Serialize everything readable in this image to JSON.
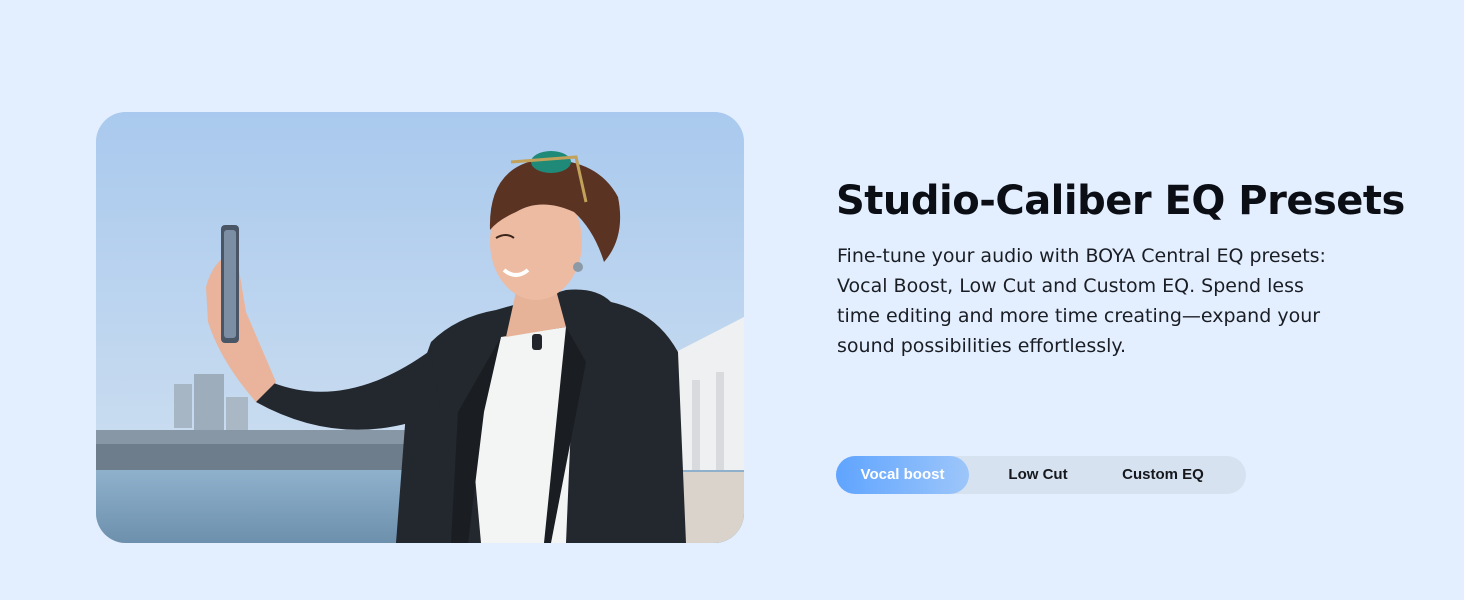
{
  "feature": {
    "title": "Studio-Caliber EQ Presets",
    "description": "Fine-tune your audio with BOYA Central EQ presets: Vocal Boost, Low Cut and Custom EQ. Spend less time editing and more time creating—expand your sound possibilities effortlessly."
  },
  "presets": {
    "options": [
      {
        "label": "Vocal boost",
        "selected": true
      },
      {
        "label": "Low Cut",
        "selected": false
      },
      {
        "label": "Custom EQ",
        "selected": false
      }
    ]
  },
  "colors": {
    "background": "#e3efff",
    "active_tab_start": "#5fa4ff",
    "active_tab_end": "#9dc6fa",
    "track": "#d6e2f0"
  },
  "image": {
    "subject": "woman-taking-selfie"
  }
}
